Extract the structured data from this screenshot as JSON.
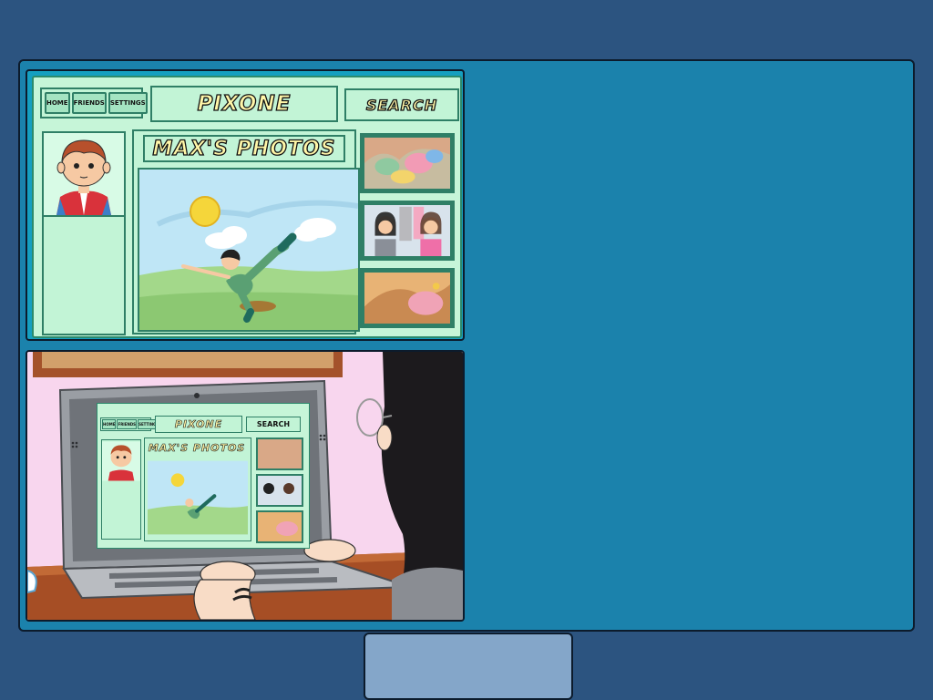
{
  "site": {
    "nav": {
      "home": "HOME",
      "friends": "FRIENDS",
      "settings": "SETTINGS"
    },
    "logo": "PIXONE",
    "search_label": "SEARCH",
    "page_title": "MAX'S PHOTOS"
  },
  "colors": {
    "page_background": "#2c5480",
    "board_background": "#1b82ac",
    "site_green": "#c6f5d8",
    "accent_text": "#fff6a8"
  }
}
